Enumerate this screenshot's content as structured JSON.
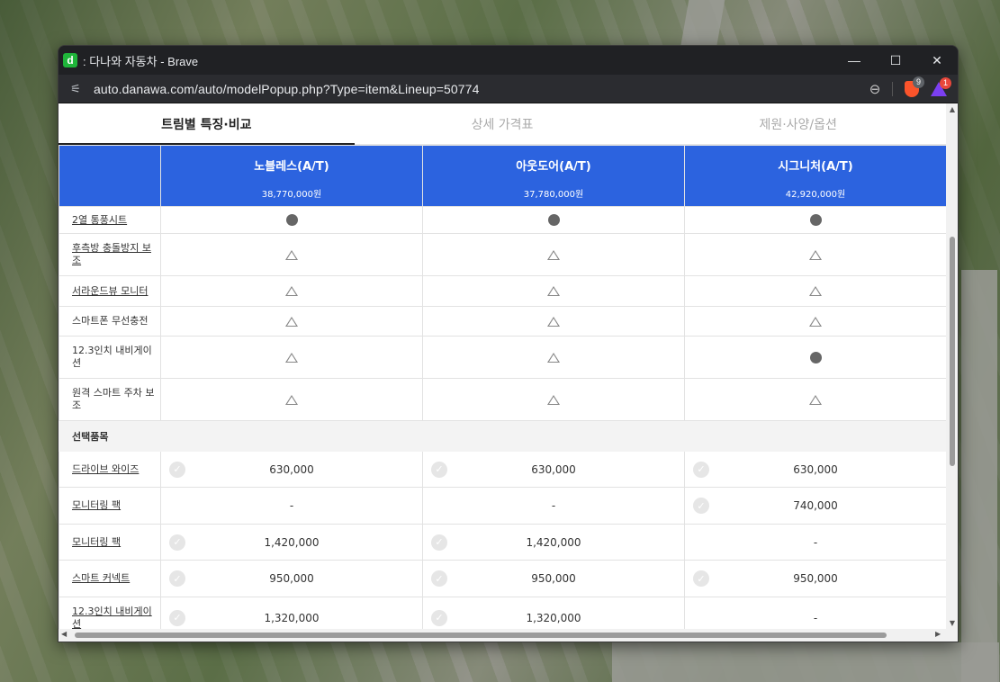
{
  "window": {
    "title": ": 다나와 자동차 - Brave",
    "favicon_letter": "d",
    "minimize": "—",
    "maximize": "☐",
    "close": "✕"
  },
  "address_bar": {
    "url": "auto.danawa.com/auto/modelPopup.php?Type=item&Lineup=50774",
    "brave_badge": "9",
    "rewards_badge": "1"
  },
  "tabs": [
    {
      "label": "트림별 특징·비교",
      "active": true
    },
    {
      "label": "상세 가격표",
      "active": false
    },
    {
      "label": "제원·사양/옵션",
      "active": false
    }
  ],
  "trims": [
    {
      "name": "노블레스(A/T)",
      "price": "38,770,000원"
    },
    {
      "name": "아웃도어(A/T)",
      "price": "37,780,000원"
    },
    {
      "name": "시그니처(A/T)",
      "price": "42,920,000원"
    }
  ],
  "feature_rows": [
    {
      "label": "2열 통풍시트",
      "link": true,
      "values": [
        "dot",
        "dot",
        "dot"
      ]
    },
    {
      "label": "후측방 충돌방지 보조",
      "link": true,
      "values": [
        "tri",
        "tri",
        "tri"
      ]
    },
    {
      "label": "서라운드뷰 모니터",
      "link": true,
      "values": [
        "tri",
        "tri",
        "tri"
      ]
    },
    {
      "label": "스마트폰 무선충전",
      "link": false,
      "values": [
        "tri",
        "tri",
        "tri"
      ]
    },
    {
      "label": "12.3인치 내비게이션",
      "link": false,
      "values": [
        "tri",
        "tri",
        "dot"
      ]
    },
    {
      "label": "원격 스마트 주차 보조",
      "link": false,
      "values": [
        "tri",
        "tri",
        "tri"
      ]
    }
  ],
  "section_label": "선택품목",
  "option_rows": [
    {
      "label": "드라이브 와이즈",
      "values": [
        "630,000",
        "630,000",
        "630,000"
      ],
      "checks": [
        true,
        true,
        true
      ]
    },
    {
      "label": "모니터링 팩",
      "values": [
        "-",
        "-",
        "740,000"
      ],
      "checks": [
        false,
        false,
        true
      ]
    },
    {
      "label": "모니터링 팩",
      "values": [
        "1,420,000",
        "1,420,000",
        "-"
      ],
      "checks": [
        true,
        true,
        false
      ]
    },
    {
      "label": "스마트 커넥트",
      "values": [
        "950,000",
        "950,000",
        "950,000"
      ],
      "checks": [
        true,
        true,
        true
      ]
    },
    {
      "label": "12.3인치 내비게이션",
      "values": [
        "1,320,000",
        "1,320,000",
        "-"
      ],
      "checks": [
        true,
        true,
        false
      ]
    }
  ]
}
